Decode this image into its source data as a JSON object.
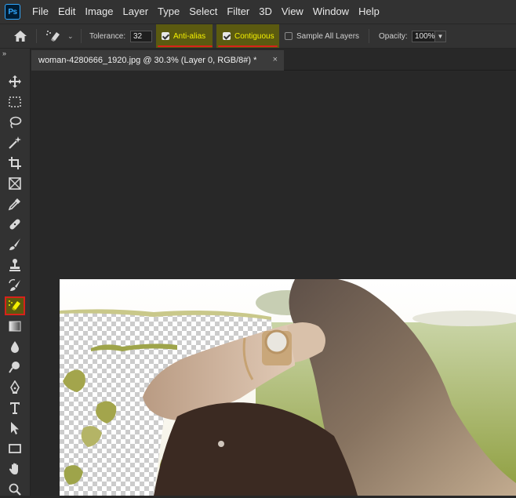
{
  "app": {
    "logo": "Ps"
  },
  "menu": [
    "File",
    "Edit",
    "Image",
    "Layer",
    "Type",
    "Select",
    "Filter",
    "3D",
    "View",
    "Window",
    "Help"
  ],
  "options": {
    "tolerance_label": "Tolerance:",
    "tolerance_value": "32",
    "anti_alias_label": "Anti-alias",
    "anti_alias_checked": true,
    "contiguous_label": "Contiguous",
    "contiguous_checked": true,
    "sample_all_layers_label": "Sample All Layers",
    "sample_all_layers_checked": false,
    "opacity_label": "Opacity:",
    "opacity_value": "100%"
  },
  "document_tab": {
    "title": "woman-4280666_1920.jpg @ 30.3% (Layer 0, RGB/8#) *",
    "close_symbol": "×"
  },
  "toolbar": {
    "collapse_symbol": "»",
    "tools": [
      "move-icon",
      "marquee-icon",
      "lasso-icon",
      "magic-wand-icon",
      "crop-icon",
      "frame-icon",
      "eyedropper-icon",
      "healing-brush-icon",
      "brush-icon",
      "clone-stamp-icon",
      "history-brush-icon",
      "background-eraser-icon",
      "gradient-icon",
      "blur-icon",
      "dodge-icon",
      "pen-icon",
      "type-icon",
      "path-selection-icon",
      "rectangle-icon",
      "hand-icon",
      "zoom-icon"
    ],
    "active_tool": "background-eraser-icon"
  },
  "colors": {
    "highlight": "#5b5a10",
    "highlight_text": "#f4f000",
    "underline": "#d8221a"
  }
}
